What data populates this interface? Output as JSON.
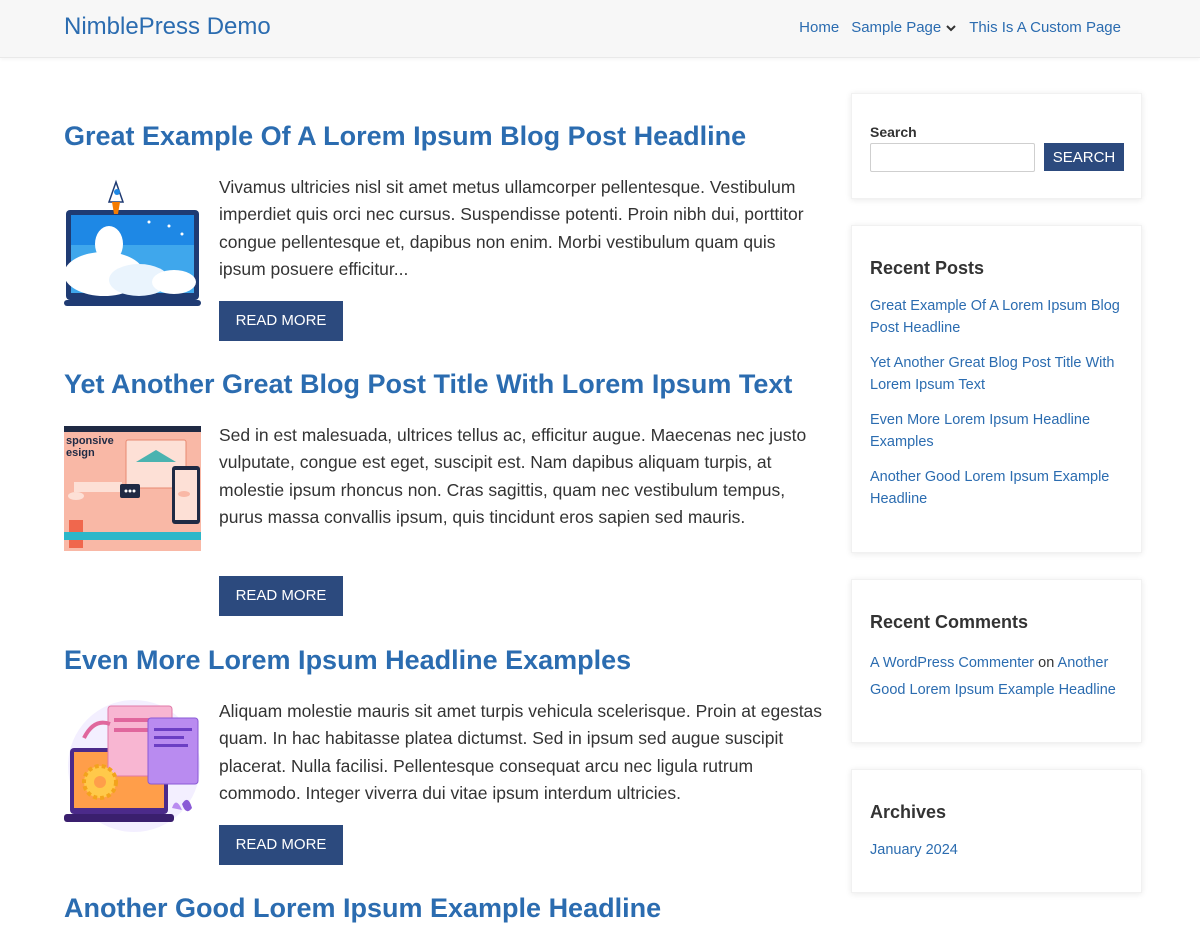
{
  "site": {
    "title": "NimblePress Demo"
  },
  "nav": {
    "home": "Home",
    "sample_page": "Sample Page",
    "custom_page": "This Is A Custom Page"
  },
  "posts": [
    {
      "title": "Great Example Of A Lorem Ipsum Blog Post Headline",
      "excerpt": "Vivamus ultricies nisl sit amet metus ullamcorper pellentesque. Vestibulum imperdiet quis orci nec cursus. Suspendisse potenti. Proin nibh dui, porttitor congue pellentesque et, dapibus non enim. Morbi vestibulum quam quis ipsum posuere efficitur...",
      "read_more": "READ MORE",
      "thumbnail": "rocket-laptop-illustration"
    },
    {
      "title": "Yet Another Great Blog Post Title With Lorem Ipsum Text",
      "excerpt": "Sed in est malesuada, ultrices tellus ac, efficitur augue. Maecenas nec justo vulputate, congue est eget, suscipit est. Nam dapibus aliquam turpis, at molestie ipsum rhoncus non. Cras sagittis, quam nec vestibulum tempus, purus massa convallis ipsum, quis tincidunt eros sapien sed mauris.",
      "read_more": "READ MORE",
      "thumbnail": "responsive-design-illustration",
      "thumb_caption": "sponsive\nesign"
    },
    {
      "title": "Even More Lorem Ipsum Headline Examples",
      "excerpt": "Aliquam molestie mauris sit amet turpis vehicula scelerisque. Proin at egestas quam. In hac habitasse platea dictumst. Sed in ipsum sed augue suscipit placerat. Nulla facilisi. Pellentesque consequat arcu nec ligula rutrum commodo. Integer viverra dui vitae ipsum interdum ultricies.",
      "read_more": "READ MORE",
      "thumbnail": "web-development-illustration"
    },
    {
      "title": "Another Good Lorem Ipsum Example Headline"
    }
  ],
  "sidebar": {
    "search": {
      "label": "Search",
      "button": "SEARCH",
      "value": ""
    },
    "recent_posts": {
      "title": "Recent Posts",
      "items": [
        "Great Example Of A Lorem Ipsum Blog Post Headline",
        "Yet Another Great Blog Post Title With Lorem Ipsum Text",
        "Even More Lorem Ipsum Headline Examples",
        "Another Good Lorem Ipsum Example Headline"
      ]
    },
    "recent_comments": {
      "title": "Recent Comments",
      "author": "A WordPress Commenter",
      "on": "on",
      "post": "Another Good Lorem Ipsum Example Headline"
    },
    "archives": {
      "title": "Archives",
      "items": [
        "January 2024"
      ]
    }
  },
  "colors": {
    "link": "#2b6cb0",
    "button": "#2c4a7e",
    "header_bg": "#f7f7f7"
  }
}
